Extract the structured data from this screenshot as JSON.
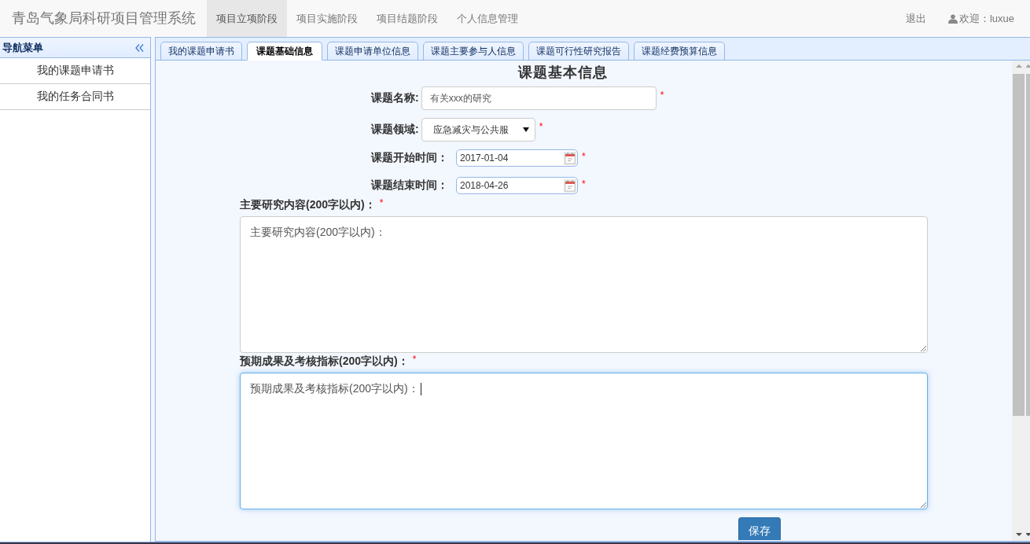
{
  "navbar": {
    "brand": "青岛气象局科研项目管理系统",
    "items": [
      {
        "label": "项目立项阶段",
        "selected": true
      },
      {
        "label": "项目实施阶段",
        "selected": false
      },
      {
        "label": "项目结题阶段",
        "selected": false
      },
      {
        "label": "个人信息管理",
        "selected": false
      }
    ],
    "logout": "退出",
    "welcome": "欢迎：luxue"
  },
  "sidebar": {
    "title": "导航菜单",
    "items": [
      "我的课题申请书",
      "我的任务合同书"
    ]
  },
  "tabs": [
    {
      "label": "我的课题申请书",
      "selected": false
    },
    {
      "label": "课题基础信息",
      "selected": true
    },
    {
      "label": "课题申请单位信息",
      "selected": false
    },
    {
      "label": "课题主要参与人信息",
      "selected": false
    },
    {
      "label": "课题可行性研究报告",
      "selected": false
    },
    {
      "label": "课题经费预算信息",
      "selected": false
    }
  ],
  "form": {
    "title": "课题基本信息",
    "fields": [
      {
        "kind": "text",
        "label": "课题名称:",
        "value": "有关xxx的研究",
        "required_mark": "*"
      },
      {
        "kind": "select",
        "label": "课题领域:",
        "value": "应急减灾与公共服",
        "required_mark": "*"
      },
      {
        "kind": "date",
        "label": "课题开始时间：",
        "value": "2017-01-04",
        "required_mark": "*"
      },
      {
        "kind": "date",
        "label": "课题结束时间：",
        "value": "2018-04-26",
        "required_mark": "*"
      }
    ],
    "textareas": [
      {
        "label": "主要研究内容(200字以内)：",
        "required_mark": "*",
        "value": "主要研究内容(200字以内)：",
        "focused": false
      },
      {
        "label": "预期成果及考核指标(200字以内)：",
        "required_mark": "*",
        "value": "预期成果及考核指标(200字以内)：",
        "focused": true
      }
    ],
    "save_button": "保存"
  }
}
